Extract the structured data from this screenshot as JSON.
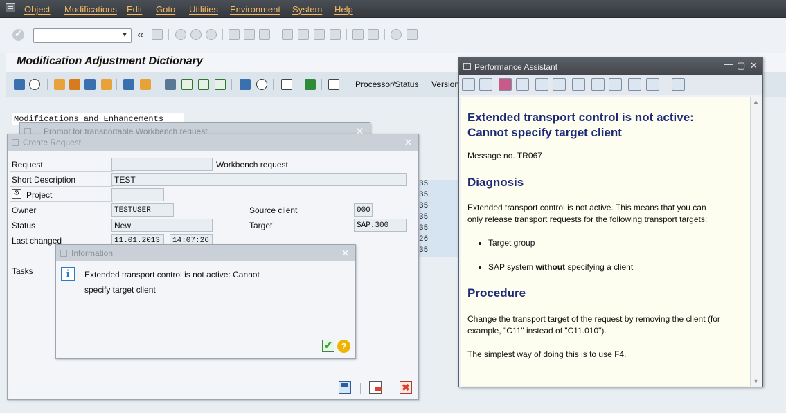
{
  "menu": {
    "items": [
      "Object",
      "Modifications",
      "Edit",
      "Goto",
      "Utilities",
      "Environment",
      "System",
      "Help"
    ]
  },
  "icons": {
    "toolbar_std": [
      "enter-icon",
      "save-icon",
      "back-icon",
      "exit-icon",
      "cancel-icon",
      "print-icon",
      "find-icon",
      "find-next-icon",
      "first-page-icon",
      "previous-page-icon",
      "next-page-icon",
      "last-page-icon",
      "new-session-icon",
      "shortcut-icon",
      "help-icon",
      "layout-icon"
    ]
  },
  "screen": {
    "title": "Modification Adjustment Dictionary",
    "toolbar": {
      "processor_status": "Processor/Status",
      "version": "Version"
    },
    "tree_label": "Modifications and Enhancements",
    "bg_cells": [
      "35",
      "35",
      "35",
      "35",
      "35",
      "26",
      "35"
    ]
  },
  "prompt_dialog": {
    "title": "Prompt for transportable Workbench request"
  },
  "create_request": {
    "title": "Create Request",
    "request_label": "Request",
    "request_type": "Workbench request",
    "short_desc_label": "Short Description",
    "short_desc_value": "TEST",
    "project_label": "Project",
    "owner_label": "Owner",
    "owner_value": "TESTUSER",
    "source_client_label": "Source client",
    "source_client_value": "000",
    "status_label": "Status",
    "status_value": "New",
    "target_label": "Target",
    "target_value": "SAP.300",
    "last_changed_label": "Last changed",
    "last_changed_date": "11.01.2013",
    "last_changed_time": "14:07:26",
    "tasks_label": "Tasks"
  },
  "info_dialog": {
    "title": "Information",
    "message_line1": "Extended transport control is not active: Cannot",
    "message_line2": "specify target client"
  },
  "perf_assistant": {
    "title": "Performance Assistant",
    "heading_line1": "Extended transport control is not active:",
    "heading_line2": "Cannot specify target client",
    "message_no": "Message no. TR067",
    "diagnosis_heading": "Diagnosis",
    "diagnosis_line1": "Extended transport control is not active. This means that you can",
    "diagnosis_line2": "only release transport requests for the following transport targets:",
    "bullet1": "Target group",
    "bullet2_pre": "SAP system ",
    "bullet2_bold": "without",
    "bullet2_post": " specifying a client",
    "procedure_heading": "Procedure",
    "procedure_line1": "Change the transport target of the request by removing the client (for",
    "procedure_line2": "example, \"C11\" instead of \"C11.010\").",
    "simplest": "The simplest way of doing this is to use F4."
  },
  "colors": {
    "menu_text": "#f4b860",
    "pa_heading": "#1e2a78",
    "pa_background": "#fefef0",
    "confirm_green": "#3aa53a",
    "help_yellow": "#f0b400",
    "cancel_red": "#d8412f"
  }
}
